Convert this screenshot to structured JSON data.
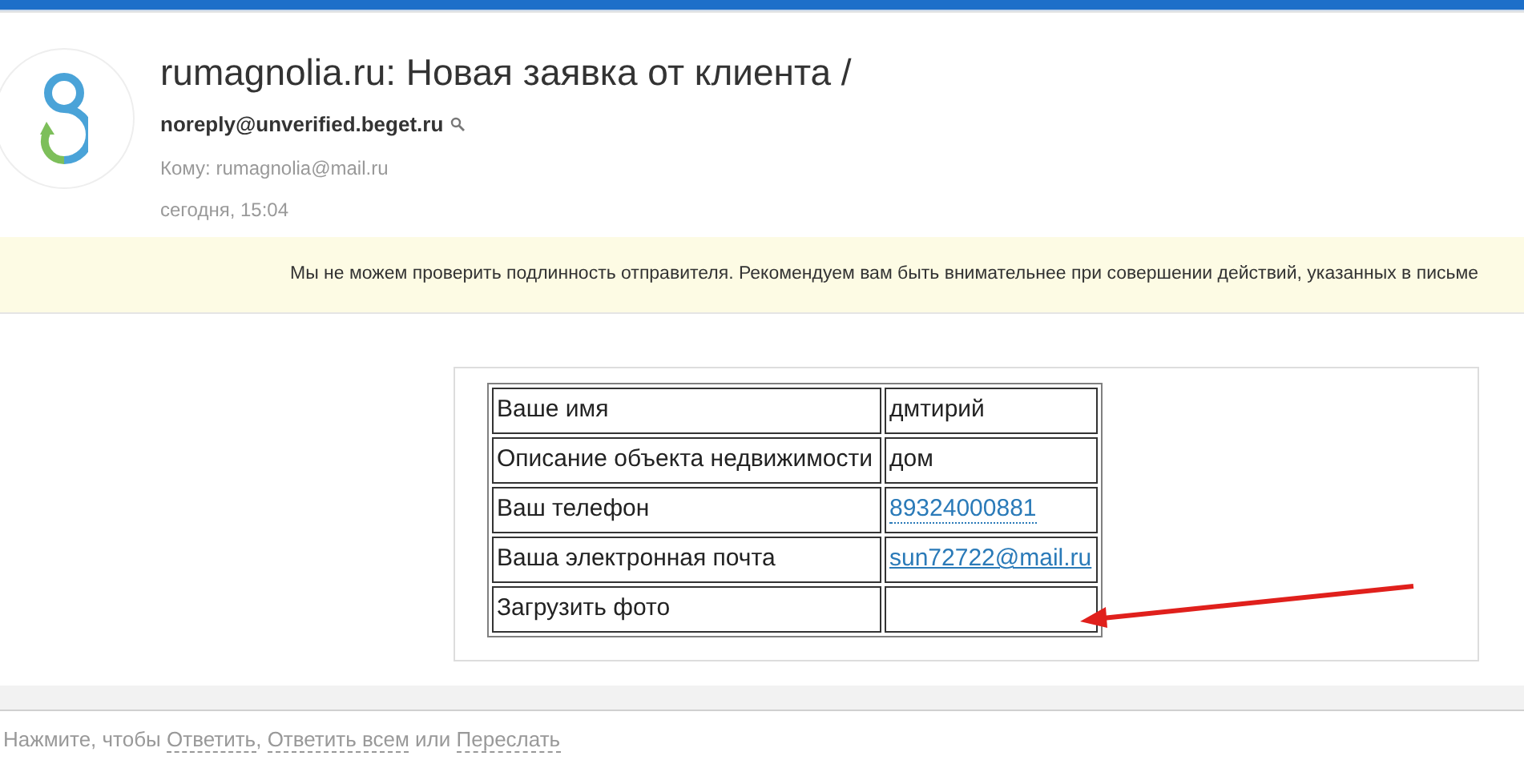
{
  "message": {
    "subject": "rumagnolia.ru: Новая заявка от клиента /",
    "sender": "noreply@unverified.beget.ru",
    "to": "Кому: rumagnolia@mail.ru",
    "date": "сегодня, 15:04"
  },
  "warning": "Мы не можем проверить подлинность отправителя. Рекомендуем вам быть внимательнее при совершении действий, указанных в письме",
  "table": {
    "rows": [
      {
        "label": "Ваше имя",
        "kind": "text",
        "value": "дмтирий"
      },
      {
        "label": "Описание объекта недвижимости",
        "kind": "text",
        "value": "дом"
      },
      {
        "label": "Ваш телефон",
        "kind": "phone",
        "value": "89324000881"
      },
      {
        "label": "Ваша электронная почта",
        "kind": "email",
        "value": "sun72722@mail.ru"
      },
      {
        "label": "Загрузить фото",
        "kind": "empty"
      }
    ]
  },
  "footer": [
    {
      "kind": "text",
      "text": "Нажмите, чтобы "
    },
    {
      "kind": "link",
      "text": "Ответить"
    },
    {
      "kind": "text",
      "text": ", "
    },
    {
      "kind": "link",
      "text": "Ответить всем"
    },
    {
      "kind": "text",
      "text": " или "
    },
    {
      "kind": "link",
      "text": "Переслать"
    }
  ]
}
